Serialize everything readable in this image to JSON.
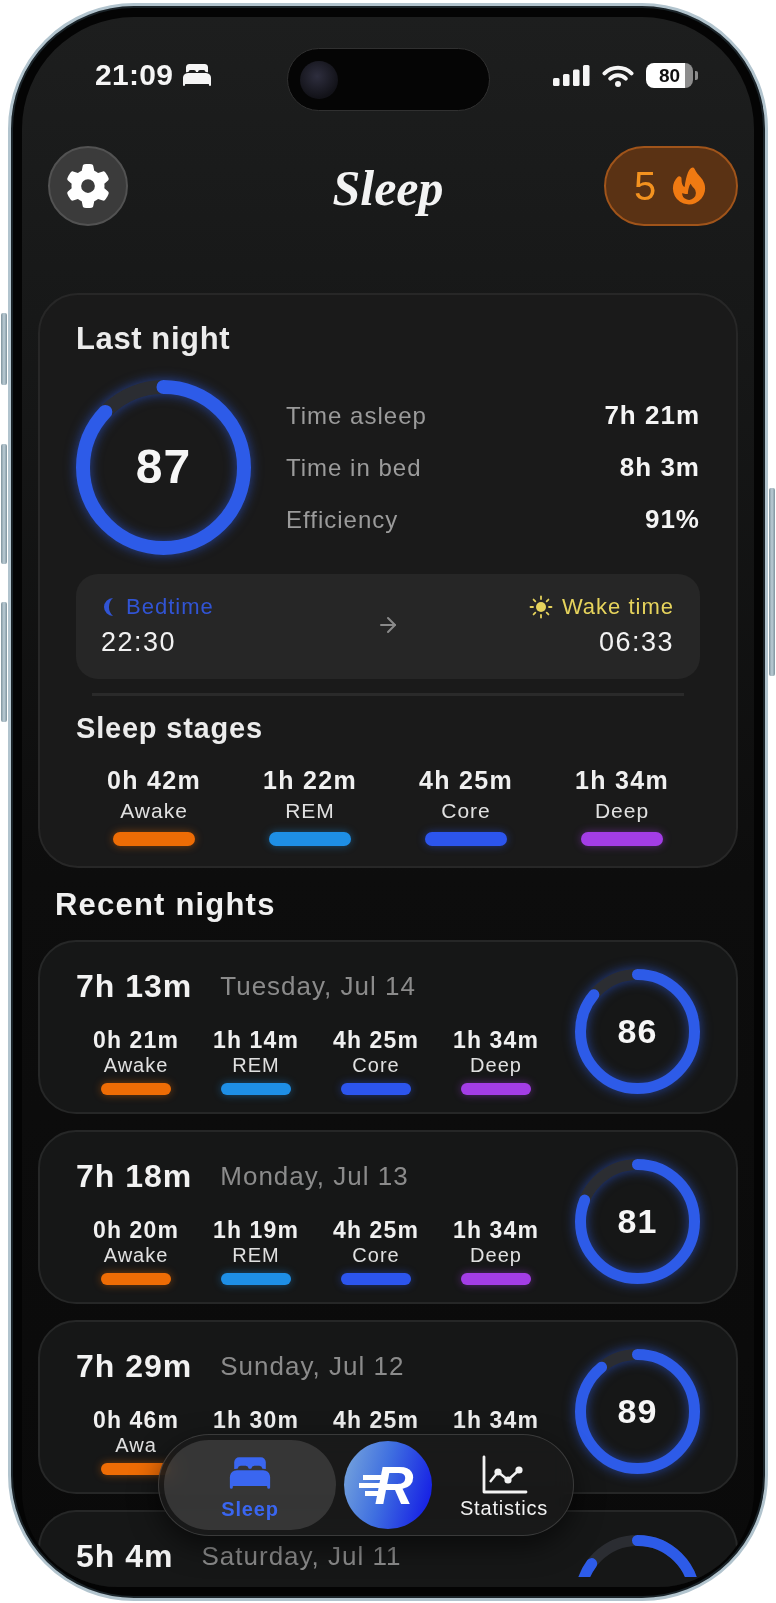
{
  "status_bar": {
    "time": "21:09",
    "battery": "80"
  },
  "header": {
    "title": "Sleep",
    "streak": "5"
  },
  "last_night": {
    "title": "Last night",
    "score": "87",
    "level": 0.87,
    "stats": [
      {
        "label": "Time asleep",
        "value": "7h 21m"
      },
      {
        "label": "Time in bed",
        "value": "8h 3m"
      },
      {
        "label": "Efficiency",
        "value": "91%"
      }
    ],
    "schedule": [
      {
        "kind": "bedtime",
        "label": "Bedtime",
        "time": "22:30",
        "color": "#3154d4"
      },
      {
        "kind": "wake",
        "label": "Wake time",
        "time": "06:33",
        "color": "#e6d35c"
      }
    ],
    "stages_title": "Sleep stages",
    "stages": [
      {
        "value": "0h 42m",
        "label": "Awake",
        "color": "#ee6c05"
      },
      {
        "value": "1h 22m",
        "label": "REM",
        "color": "#1e8fe6"
      },
      {
        "value": "4h 25m",
        "label": "Core",
        "color": "#2c55ee"
      },
      {
        "value": "1h 34m",
        "label": "Deep",
        "color": "#a33de6"
      }
    ]
  },
  "recent_nights": {
    "title": "Recent nights",
    "nights": [
      {
        "duration": "7h 13m",
        "date": "Tuesday, Jul 14",
        "score": "86",
        "level": 0.86,
        "stages": [
          {
            "value": "0h 21m",
            "label": "Awake",
            "color": "#ee6c05"
          },
          {
            "value": "1h 14m",
            "label": "REM",
            "color": "#1e8fe6"
          },
          {
            "value": "4h 25m",
            "label": "Core",
            "color": "#2c55ee"
          },
          {
            "value": "1h 34m",
            "label": "Deep",
            "color": "#a33de6"
          }
        ]
      },
      {
        "duration": "7h 18m",
        "date": "Monday, Jul 13",
        "score": "81",
        "level": 0.81,
        "stages": [
          {
            "value": "0h 20m",
            "label": "Awake",
            "color": "#ee6c05"
          },
          {
            "value": "1h 19m",
            "label": "REM",
            "color": "#1e8fe6"
          },
          {
            "value": "4h 25m",
            "label": "Core",
            "color": "#2c55ee"
          },
          {
            "value": "1h 34m",
            "label": "Deep",
            "color": "#a33de6"
          }
        ]
      },
      {
        "duration": "7h 29m",
        "date": "Sunday, Jul 12",
        "score": "89",
        "level": 0.89,
        "stages": [
          {
            "value": "0h 46m",
            "label": "Awa",
            "color": "#ee6c05"
          },
          {
            "value": "1h 30m"
          },
          {
            "value": "4h 25m"
          },
          {
            "value": "1h 34m"
          }
        ]
      },
      {
        "duration": "5h 4m",
        "date": "Saturday, Jul 11"
      }
    ]
  },
  "tab_bar": {
    "items": [
      {
        "kind": "tab",
        "label": "Sleep",
        "selected": true
      },
      {
        "kind": "logo",
        "label": "R"
      },
      {
        "kind": "tab",
        "label": "Statistics",
        "selected": false
      }
    ]
  }
}
